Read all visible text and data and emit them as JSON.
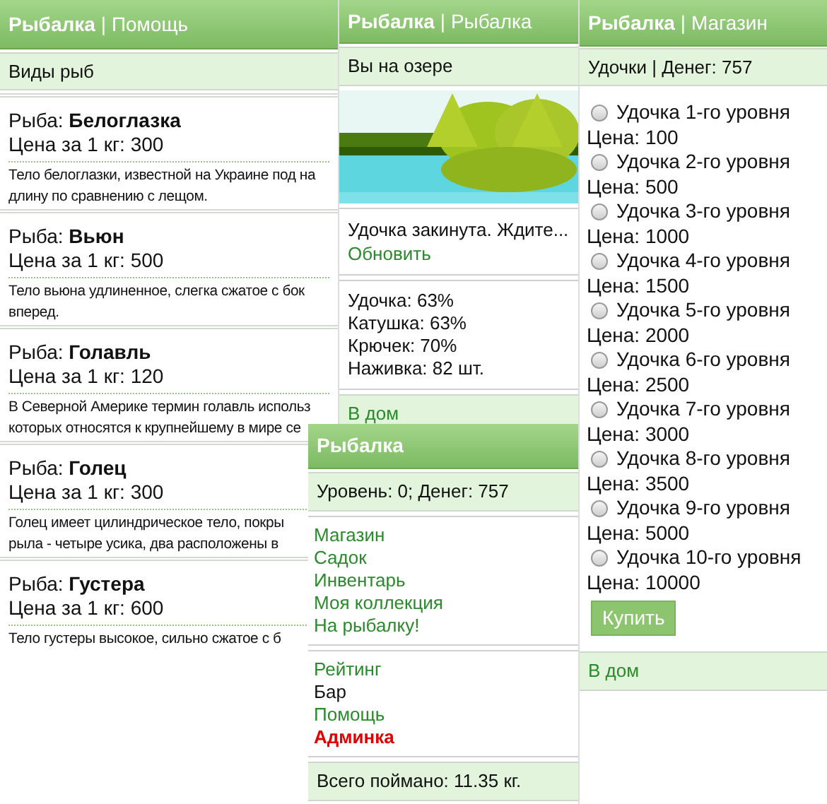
{
  "help_screen": {
    "title": "Рыбалка",
    "section": "| Помощь",
    "subheader": "Виды рыб",
    "fish": [
      {
        "name": "Рыба: **Белоглазка**",
        "price": "Цена за 1 кг: 300",
        "description": [
          "Тело белоглазки, известной на Украине под на",
          "длину по сравнению с лещом."
        ]
      },
      {
        "name": "Рыба: **Вьюн**",
        "price": "Цена за 1 кг: 500",
        "description": [
          "Тело вьюна удлиненное, слегка сжатое с бок",
          "вперед."
        ]
      },
      {
        "name": "Рыба: **Голавль**",
        "price": "Цена за 1 кг: 120",
        "description": [
          "В Северной Америке термин голавль использ",
          "которых относятся к крупнейшему в мире се"
        ]
      },
      {
        "name": "Рыба: **Голец**",
        "price": "Цена за 1 кг: 300",
        "description": [
          "Голец имеет цилиндрическое тело, покры",
          "рыла - четыре усика, два расположены в"
        ]
      },
      {
        "name": "Рыба: **Густера**",
        "price": "Цена за 1 кг: 600",
        "description": [
          "Тело густеры высокое, сильно сжатое с б"
        ]
      }
    ]
  },
  "fishing_screen": {
    "title": "Рыбалка",
    "section": "| Рыбалка",
    "subheader": "Вы на озере",
    "status": "Удочка закинута. Ждите...",
    "refresh_link": "Обновить",
    "stats": [
      "Удочка: 63%",
      "Катушка: 63%",
      "Крючек: 70%",
      "Наживка: 82 шт."
    ],
    "home_link": "В дом"
  },
  "shop_screen": {
    "title": "Рыбалка",
    "section": "| Магазин",
    "subheader": "Удочки | Денег: 757",
    "rods": [
      {
        "name": "Удочка 1-го уровня",
        "price": "Цена: 100",
        "selected": false
      },
      {
        "name": "Удочка 2-го уровня",
        "price": "Цена: 500",
        "selected": false
      },
      {
        "name": "Удочка 3-го уровня",
        "price": "Цена: 1000",
        "selected": false
      },
      {
        "name": "Удочка 4-го уровня",
        "price": "Цена: 1500",
        "selected": false
      },
      {
        "name": "Удочка 5-го уровня",
        "price": "Цена: 2000",
        "selected": false
      },
      {
        "name": "Удочка 6-го уровня",
        "price": "Цена: 2500",
        "selected": false
      },
      {
        "name": "Удочка 7-го уровня",
        "price": "Цена: 3000",
        "selected": false
      },
      {
        "name": "Удочка 8-го уровня",
        "price": "Цена: 3500",
        "selected": false
      },
      {
        "name": "Удочка 9-го уровня",
        "price": "Цена: 5000",
        "selected": false
      },
      {
        "name": "Удочка 10-го уровня",
        "price": "Цена: 10000",
        "selected": false
      }
    ],
    "buy_button": "Купить",
    "home_link": "В дом"
  },
  "menu_screen": {
    "title": "Рыбалка",
    "subheader": "Уровень: 0; Денег: 757",
    "links": [
      {
        "label": "Магазин",
        "kind": "link"
      },
      {
        "label": "Садок",
        "kind": "link"
      },
      {
        "label": "Инвентарь",
        "kind": "link"
      },
      {
        "label": "Моя коллекция",
        "kind": "link"
      },
      {
        "label": "На рыбалку!",
        "kind": "link"
      }
    ],
    "links_2": [
      {
        "label": "Рейтинг",
        "kind": "link"
      },
      {
        "label": "Бар",
        "kind": "plain"
      },
      {
        "label": "Помощь",
        "kind": "link"
      },
      {
        "label": "Админка",
        "kind": "admin"
      }
    ],
    "footer": "Всего поймано: 11.35 кг."
  }
}
